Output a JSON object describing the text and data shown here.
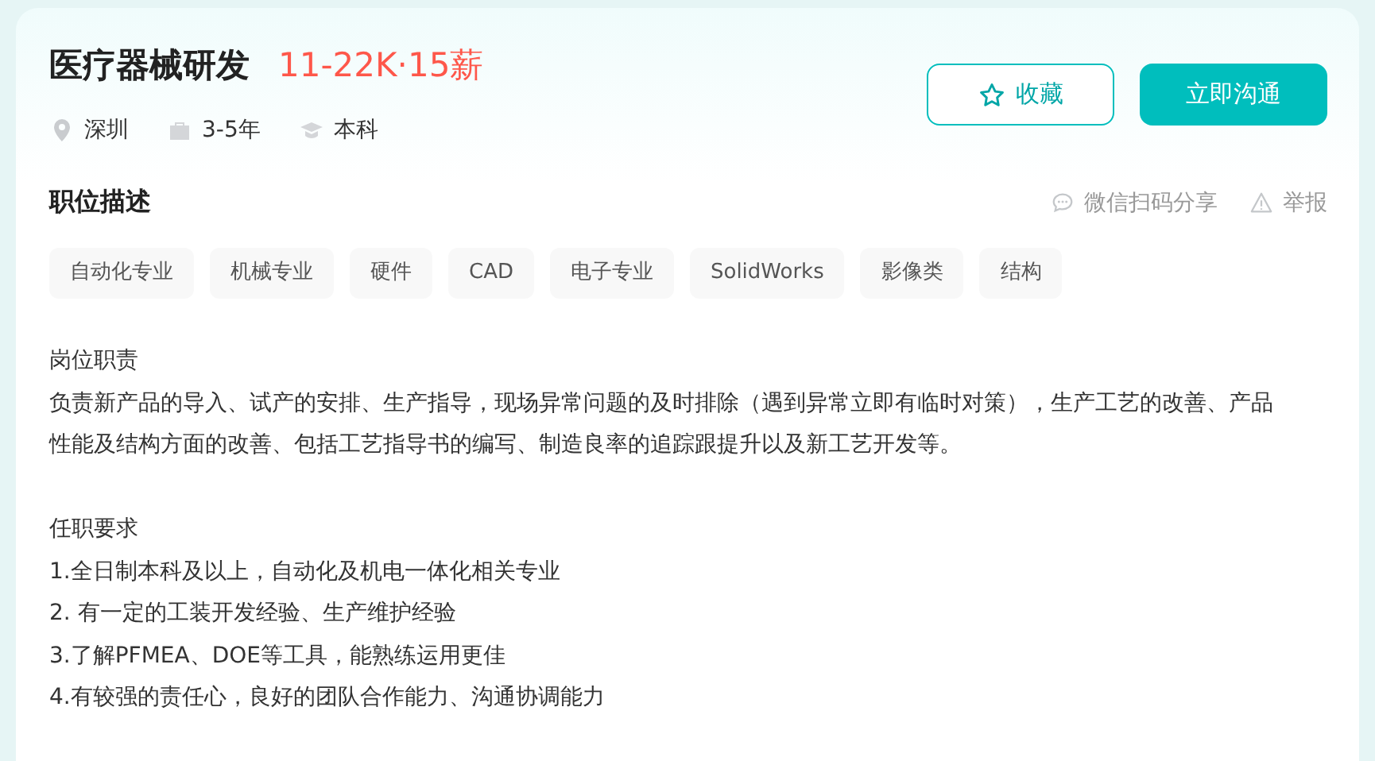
{
  "job": {
    "title": "医疗器械研发",
    "salary": "11-22K·15薪",
    "meta": [
      {
        "kind": "location",
        "text": "深圳"
      },
      {
        "kind": "experience",
        "text": "3-5年"
      },
      {
        "kind": "education",
        "text": "本科"
      }
    ]
  },
  "actions": [
    {
      "kind": "favorite",
      "label": "收藏"
    },
    {
      "kind": "chat",
      "label": "立即沟通"
    }
  ],
  "section": {
    "title": "职位描述",
    "links": [
      {
        "kind": "share",
        "label": "微信扫码分享"
      },
      {
        "kind": "report",
        "label": "举报"
      }
    ]
  },
  "tags": [
    "自动化专业",
    "机械专业",
    "硬件",
    "CAD",
    "电子专业",
    "SolidWorks",
    "影像类",
    "结构"
  ],
  "description": [
    {
      "heading": "岗位职责",
      "lines": [
        "负责新产品的导入、试产的安排、生产指导，现场异常问题的及时排除（遇到异常立即有临时对策），生产工艺的改善、产品性能及结构方面的改善、包括工艺指导书的编写、制造良率的追踪跟提升以及新工艺开发等。"
      ]
    },
    {
      "heading": "任职要求",
      "lines": [
        "1.全日制本科及以上，自动化及机电一体化相关专业",
        "2. 有一定的工装开发经验、生产维护经验",
        "3.了解PFMEA、DOE等工具，能熟练运用更佳",
        "4.有较强的责任心，良好的团队合作能力、沟通协调能力"
      ]
    }
  ]
}
